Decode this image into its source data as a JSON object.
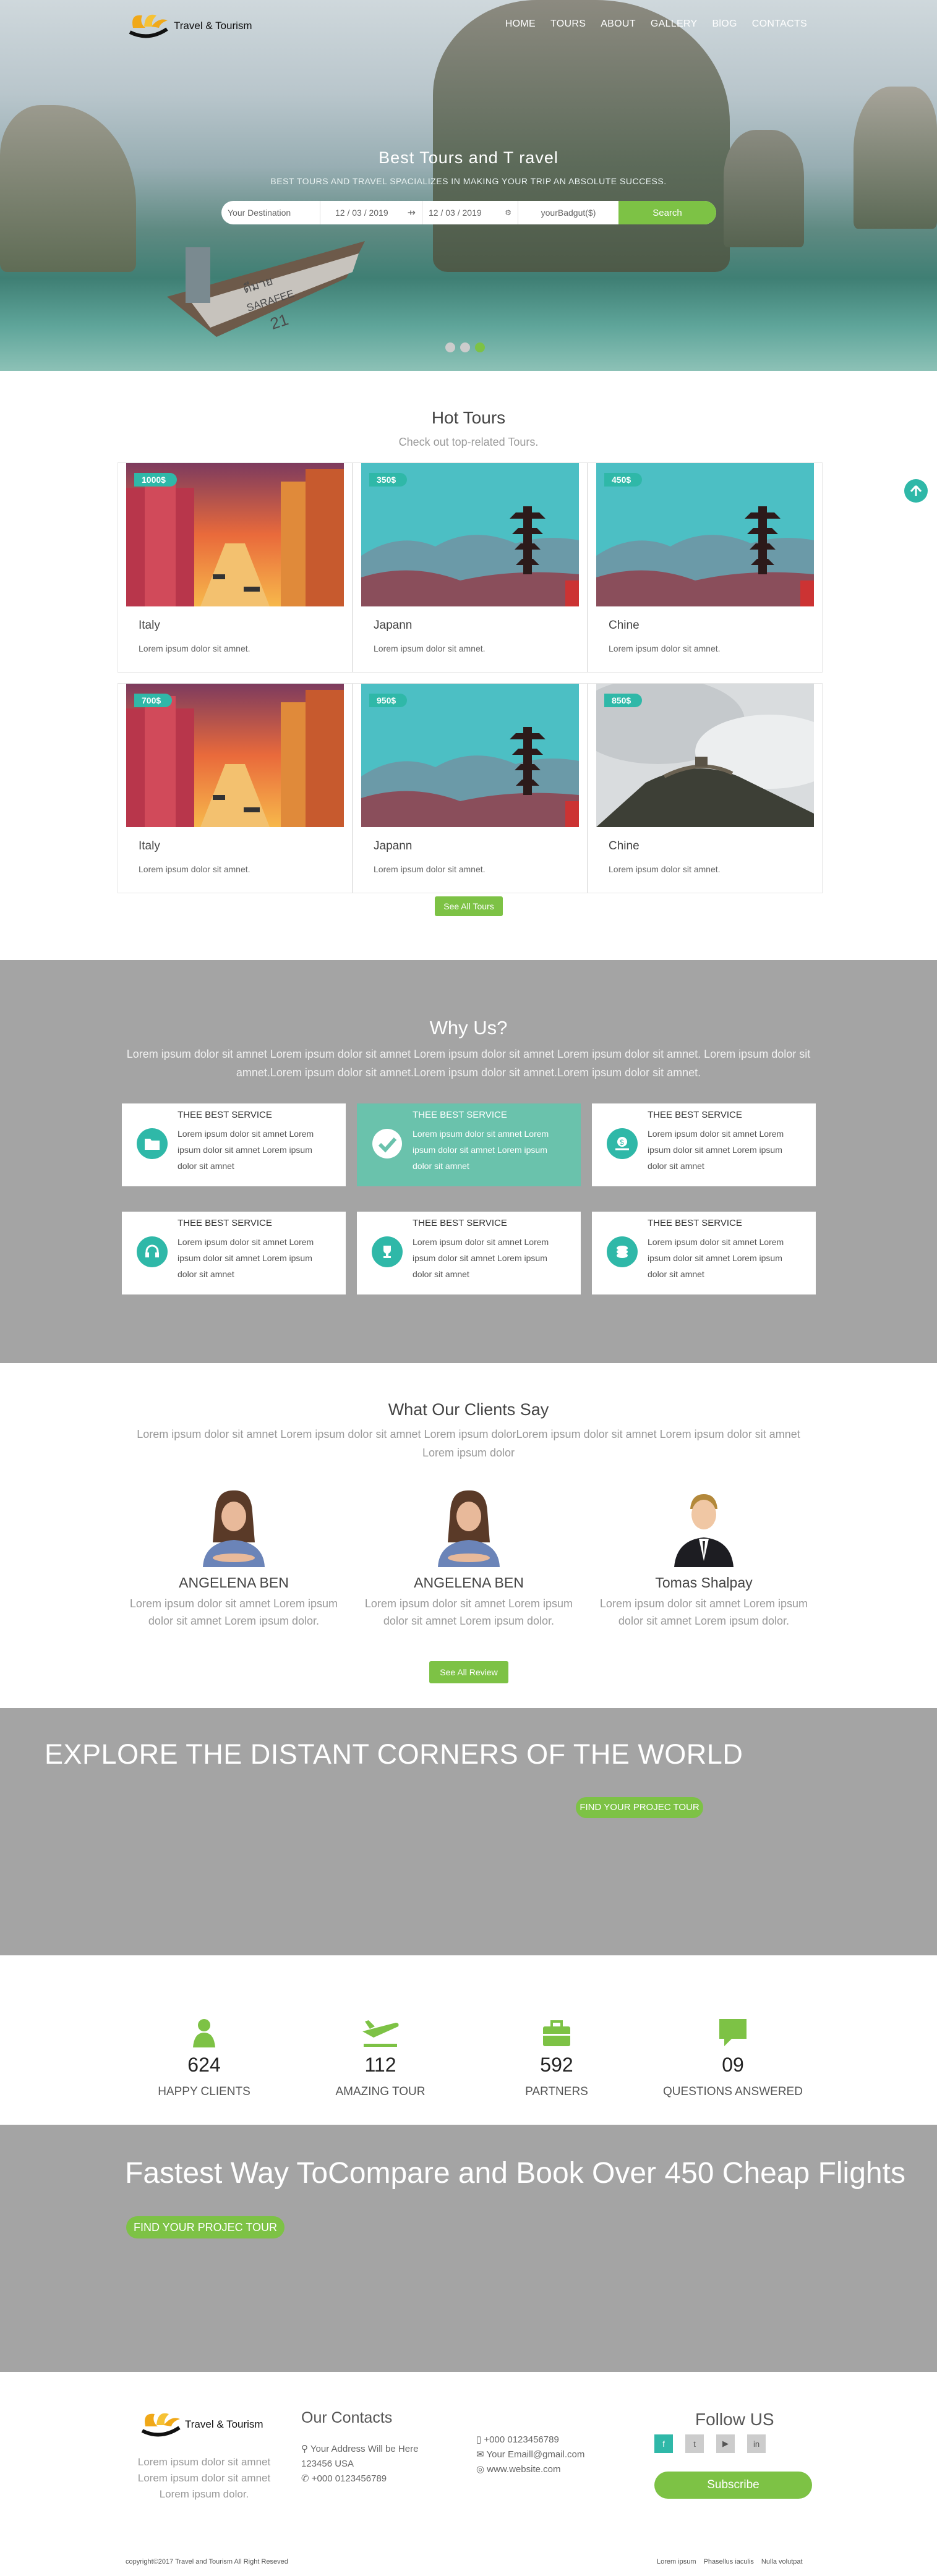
{
  "header": {
    "logo_text": "Travel & Tourism",
    "nav": [
      "HOME",
      "TOURS",
      "ABOUT",
      "GALLERY",
      "BlOG",
      "CONTACTS"
    ]
  },
  "hero": {
    "title": "Best Tours and T ravel",
    "subtitle": "BEST TOURS AND TRAVEL SPACIALIZES IN MAKING YOUR TRIP AN ABSOLUTE SUCCESS.",
    "destination_placeholder": "Your Destination",
    "date_from": "12 / 03 / 2019",
    "date_to": "12 / 03 / 2019",
    "budget_placeholder": "yourBadgut($)",
    "search_label": "Search",
    "boat_text": [
      "ดีมาย",
      "SARAFEE",
      "21"
    ]
  },
  "hot_tours": {
    "title": "Hot Tours",
    "subtitle": "Check out top-related Tours.",
    "cards": [
      {
        "price": "1000$",
        "name": "Italy",
        "desc": "Lorem ipsum dolor sit amnet.",
        "scene": "city"
      },
      {
        "price": "350$",
        "name": "Japann",
        "desc": "Lorem ipsum dolor sit amnet.",
        "scene": "pagoda"
      },
      {
        "price": "450$",
        "name": "Chine",
        "desc": "Lorem ipsum dolor sit amnet.",
        "scene": "pagoda"
      },
      {
        "price": "700$",
        "name": "Italy",
        "desc": "Lorem ipsum dolor sit amnet.",
        "scene": "city"
      },
      {
        "price": "950$",
        "name": "Japann",
        "desc": "Lorem ipsum dolor sit amnet.",
        "scene": "pagoda"
      },
      {
        "price": "850$",
        "name": "Chine",
        "desc": "Lorem ipsum dolor sit amnet.",
        "scene": "wall"
      }
    ],
    "see_all": "See All Tours"
  },
  "why_us": {
    "title": "Why Us?",
    "text": "Lorem ipsum dolor sit amnet Lorem ipsum dolor sit amnet Lorem ipsum dolor sit amnet Lorem ipsum dolor sit amnet. Lorem ipsum dolor sit amnet.Lorem ipsum dolor sit amnet.Lorem ipsum dolor sit amnet.Lorem ipsum dolor sit amnet.",
    "items": [
      {
        "title": "THEE BEST SERVICE",
        "desc": "Lorem ipsum dolor sit amnet Lorem ipsum dolor sit amnet Lorem ipsum dolor sit amnet",
        "icon": "folder-icon",
        "highlight": false
      },
      {
        "title": "THEE BEST SERVICE",
        "desc": "Lorem ipsum dolor sit amnet Lorem ipsum dolor sit amnet Lorem ipsum dolor sit amnet",
        "icon": "check-circle-icon",
        "highlight": true
      },
      {
        "title": "THEE BEST SERVICE",
        "desc": "Lorem ipsum dolor sit amnet Lorem ipsum dolor sit amnet Lorem ipsum dolor sit amnet",
        "icon": "money-hand-icon",
        "highlight": false
      },
      {
        "title": "THEE BEST SERVICE",
        "desc": "Lorem ipsum dolor sit amnet Lorem ipsum dolor sit amnet Lorem ipsum dolor sit amnet",
        "icon": "headset-icon",
        "highlight": false
      },
      {
        "title": "THEE BEST SERVICE",
        "desc": "Lorem ipsum dolor sit amnet Lorem ipsum dolor sit amnet Lorem ipsum dolor sit amnet",
        "icon": "trophy-icon",
        "highlight": false
      },
      {
        "title": "THEE BEST SERVICE",
        "desc": "Lorem ipsum dolor sit amnet Lorem ipsum dolor sit amnet Lorem ipsum dolor sit amnet",
        "icon": "coins-icon",
        "highlight": false
      }
    ]
  },
  "clients": {
    "title": "What Our Clients Say",
    "text": "Lorem ipsum dolor sit amnet Lorem ipsum dolor sit amnet Lorem ipsum dolorLorem ipsum dolor sit amnet Lorem ipsum dolor sit amnet Lorem ipsum dolor",
    "items": [
      {
        "name": "ANGELENA BEN",
        "quote": "Lorem ipsum dolor sit amnet Lorem ipsum dolor sit amnet Lorem ipsum dolor.",
        "avatar": "woman"
      },
      {
        "name": "ANGELENA BEN",
        "quote": "Lorem ipsum dolor sit amnet Lorem ipsum dolor sit amnet Lorem ipsum dolor.",
        "avatar": "woman"
      },
      {
        "name": "Tomas Shalpay",
        "quote": "Lorem ipsum dolor sit amnet Lorem ipsum dolor sit amnet Lorem ipsum dolor.",
        "avatar": "man"
      }
    ],
    "see_all": "See All Review"
  },
  "explore": {
    "title": "EXPLORE THE DISTANT CORNERS OF THE WORLD",
    "button": "FIND YOUR PROJEC TOUR"
  },
  "stats": [
    {
      "num": "624",
      "label": "HAPPY CLIENTS",
      "icon": "user-icon"
    },
    {
      "num": "112",
      "label": "AMAZING TOUR",
      "icon": "plane-icon"
    },
    {
      "num": "592",
      "label": "PARTNERS",
      "icon": "briefcase-icon"
    },
    {
      "num": "09",
      "label": "QUESTIONS ANSWERED",
      "icon": "chat-icon"
    }
  ],
  "flights": {
    "title": "Fastest Way ToCompare and Book Over 450 Cheap Flights",
    "button": "FIND YOUR PROJEC TOUR"
  },
  "footer": {
    "logo_text": "Travel & Tourism",
    "about": "Lorem ipsum dolor sit amnet Lorem ipsum dolor sit amnet Lorem ipsum dolor.",
    "contacts_title": "Our Contacts",
    "address": "Your Address Will be Here 123456 USA",
    "phone1": "+000 0123456789",
    "phone2": "+000 0123456789",
    "email": "Your Emaill@gmail.com",
    "website": "www.website.com",
    "follow_title": "Follow US",
    "social": [
      "f",
      "t",
      "▶",
      "in"
    ],
    "subscribe": "Subscribe",
    "copyright": "copyright©2017 Travel and Tourism All Right Reseved",
    "links": [
      "Lorem ipsum",
      "Phasellus iaculis",
      "Nulla volutpat"
    ]
  },
  "colors": {
    "accent": "#7dc245",
    "teal": "#2fb8a8",
    "grey_band": "#a4a4a4"
  }
}
